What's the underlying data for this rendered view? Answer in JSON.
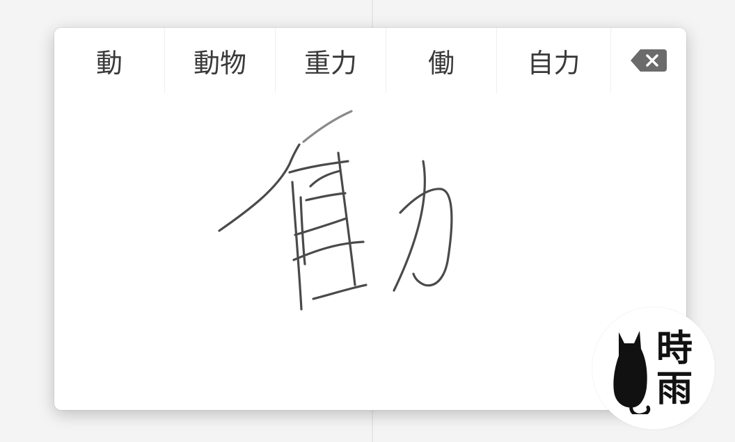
{
  "candidates": [
    {
      "label": "動"
    },
    {
      "label": "動物"
    },
    {
      "label": "重力"
    },
    {
      "label": "働"
    },
    {
      "label": "自力"
    }
  ],
  "delete_icon": "backspace-icon",
  "watermark": {
    "chars": [
      "時",
      "雨"
    ],
    "icon": "cat-silhouette-icon"
  },
  "colors": {
    "stroke": "#4a4a4a",
    "candidate_text": "#3a3a3a",
    "delete_icon_fill": "#6b6b6b"
  }
}
